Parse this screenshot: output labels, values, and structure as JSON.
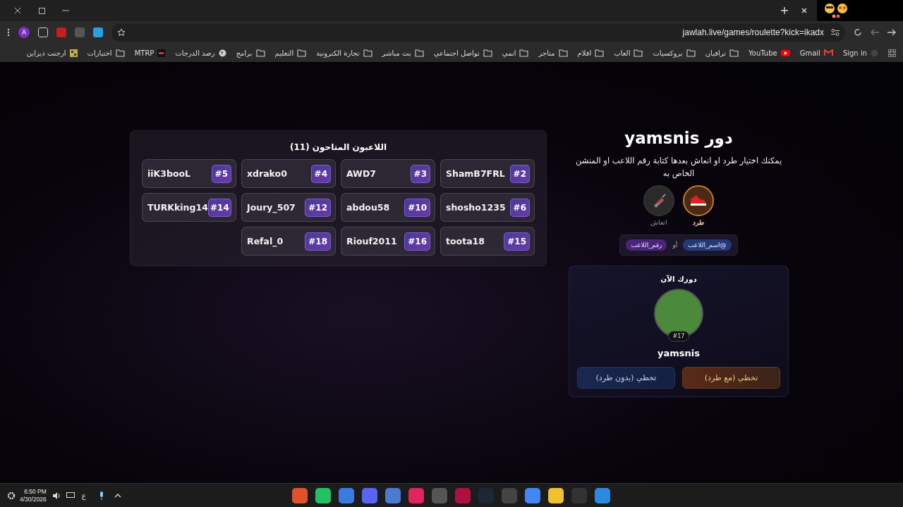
{
  "browser": {
    "url": "jawlah.live/games/roulette?kick=ikadx",
    "profile_initial": "A",
    "bookmarks": [
      {
        "label": "Sign in",
        "kind": "link"
      },
      {
        "label": "Gmail",
        "kind": "gmail"
      },
      {
        "label": "YouTube",
        "kind": "youtube"
      },
      {
        "label": "ترافيان",
        "kind": "folder"
      },
      {
        "label": "بروكسيات",
        "kind": "folder"
      },
      {
        "label": "العاب",
        "kind": "folder"
      },
      {
        "label": "افلام",
        "kind": "folder"
      },
      {
        "label": "متاجر",
        "kind": "folder"
      },
      {
        "label": "انمي",
        "kind": "folder"
      },
      {
        "label": "تواصل اجتماعي",
        "kind": "folder"
      },
      {
        "label": "بث مباشر",
        "kind": "folder"
      },
      {
        "label": "تجارة الكترونية",
        "kind": "folder"
      },
      {
        "label": "التعليم",
        "kind": "folder"
      },
      {
        "label": "برامج",
        "kind": "folder"
      },
      {
        "label": "رصد الدرجات",
        "kind": "globe"
      },
      {
        "label": "MTRP",
        "kind": "mtrp"
      },
      {
        "label": "اختبارات",
        "kind": "folder"
      },
      {
        "label": "ارجنت ديزاين",
        "kind": "grid"
      }
    ]
  },
  "players": {
    "title": "اللاعبون المتاحون (11)",
    "items": [
      {
        "name": "ShamB7FRL",
        "number": "#2"
      },
      {
        "name": "AWD7",
        "number": "#3"
      },
      {
        "name": "xdrako0",
        "number": "#4"
      },
      {
        "name": "iiK3booL",
        "number": "#5"
      },
      {
        "name": "shosho1235",
        "number": "#6"
      },
      {
        "name": "abdou58",
        "number": "#10"
      },
      {
        "name": "Joury_507",
        "number": "#12"
      },
      {
        "name": "TURKking14",
        "number": "#14"
      },
      {
        "name": "toota18",
        "number": "#15"
      },
      {
        "name": "Riouf2011",
        "number": "#16"
      },
      {
        "name": "Refal_0",
        "number": "#18"
      }
    ]
  },
  "turn": {
    "title": "دور yamsnis",
    "instructions": "يمكنك اختيار طرد او انعاش بعدها كتابة رقم اللاعب او المنشن الخاص به",
    "actions": [
      {
        "label": "طرد",
        "kind": "kick",
        "selected": true
      },
      {
        "label": "انعاش",
        "kind": "revive",
        "selected": false
      }
    ],
    "formats": [
      {
        "label": "@اسم_اللاعب",
        "kind": "mention"
      },
      {
        "label": "أو",
        "kind": "separator"
      },
      {
        "label": "رقم_اللاعب",
        "kind": "number"
      }
    ]
  },
  "current": {
    "title": "دورك الآن",
    "number": "#17",
    "name": "yamsnis",
    "buttons": [
      {
        "label": "تخطي (مع طرد)",
        "kind": "kick"
      },
      {
        "label": "تخطي (بدون طرد)",
        "kind": "plain"
      }
    ]
  },
  "taskbar": {
    "time": "6:50 PM",
    "date": "4/30/2026",
    "language": "ع"
  }
}
